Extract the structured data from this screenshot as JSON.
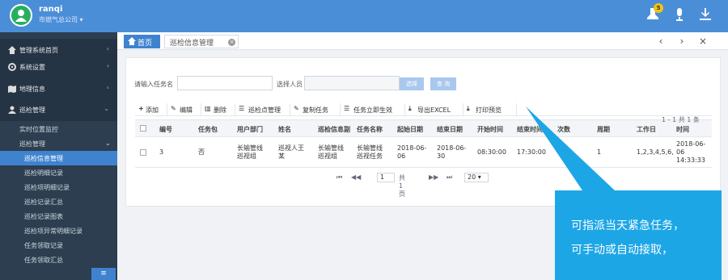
{
  "header": {
    "username": "ranqi",
    "company": "市燃气总公司 ▾",
    "notification_count": "5",
    "accent": "#4b8ed8"
  },
  "sidebar": {
    "groups": [
      {
        "icon": "home-icon",
        "label": "管理系统首页",
        "chevron": "‹"
      },
      {
        "icon": "gear-icon",
        "label": "系统设置",
        "chevron": "‹"
      },
      {
        "icon": "map-icon",
        "label": "地理信息",
        "chevron": "‹"
      },
      {
        "icon": "user-icon",
        "label": "巡检管理",
        "chevron": "⌄"
      }
    ],
    "items": [
      {
        "label": "实时位置监控"
      },
      {
        "label": "巡检管理",
        "chevron": "⌄"
      },
      {
        "label": "巡检信息管理"
      },
      {
        "label": "巡检明细记录"
      },
      {
        "label": "巡检项明细记录"
      },
      {
        "label": "巡检记录汇总"
      },
      {
        "label": "巡检记录图表"
      },
      {
        "label": "巡检项异常明细记录"
      },
      {
        "label": "任务领取记录"
      },
      {
        "label": "任务领取汇总"
      }
    ],
    "collapse_icon": "≡"
  },
  "tabs": {
    "home": "首页",
    "current": "巡检信息管理",
    "close": "×",
    "prev": "‹",
    "next": "›",
    "close_all": "×"
  },
  "search": {
    "task_label": "请输入任务名",
    "person_label": "选择人员",
    "select_button": "选择",
    "query_button": "查 询"
  },
  "toolbar": {
    "add": "添加",
    "edit": "编辑",
    "delete": "删除",
    "point_manage": "巡检点管理",
    "copy_task": "复制任务",
    "task_effective": "任务立即生效",
    "export_excel": "导出EXCEL",
    "print_preview": "打印预览"
  },
  "table": {
    "headers": [
      "编号",
      "任务包",
      "用户部门",
      "姓名",
      "巡检信息副",
      "任务名称",
      "起始日期",
      "结束日期",
      "开始时间",
      "结束时间",
      "次数",
      "周期",
      "工作日",
      "时间"
    ],
    "rows": [
      [
        "3",
        "否",
        "长输管线\n巡视组",
        "巡视人王\n某",
        "长输管线\n巡视组",
        "长输管线\n巡视任务",
        "2018-06-\n06",
        "2018-06-\n30",
        "08:30:00",
        "17:30:00",
        "",
        "1",
        "1,2,3,4,5,6,",
        "2018-06-\n06\n14:33:33"
      ]
    ]
  },
  "pager": {
    "first": "⏮",
    "prev": "◀◀",
    "page": "1",
    "total_pages": "共 1 页",
    "next": "▶▶",
    "last": "⏭",
    "page_size": "20 ▾",
    "range": "1 - 1  共 1 条"
  },
  "callout": {
    "line1": "可指派当天紧急任务，",
    "line2": "可手动或自动接取，",
    "color": "#1da6e6"
  }
}
